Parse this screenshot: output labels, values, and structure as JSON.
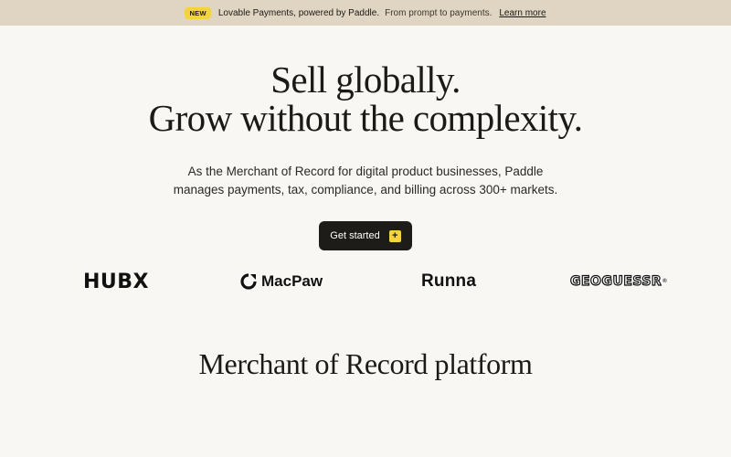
{
  "announcement": {
    "badge": "NEW",
    "headline": "Lovable Payments, powered by Paddle.",
    "subtext": "From prompt to payments.",
    "link": "Learn more"
  },
  "hero": {
    "title_line1": "Sell globally.",
    "title_line2": "Grow without the complexity.",
    "description": "As the Merchant of Record for digital product businesses, Paddle manages payments, tax, compliance, and billing across 300+ markets.",
    "cta_label": "Get started",
    "cta_icon": "+"
  },
  "logos": [
    {
      "name": "HUBX"
    },
    {
      "name": "MacPaw"
    },
    {
      "name": "Runna"
    },
    {
      "name": "GEOGUESSR"
    }
  ],
  "section": {
    "title": "Merchant of Record platform"
  },
  "colors": {
    "background": "#f8f7f3",
    "announcement_bg": "#e0d5c2",
    "accent_yellow": "#f5d33b",
    "button_dark": "#1d1c19"
  }
}
